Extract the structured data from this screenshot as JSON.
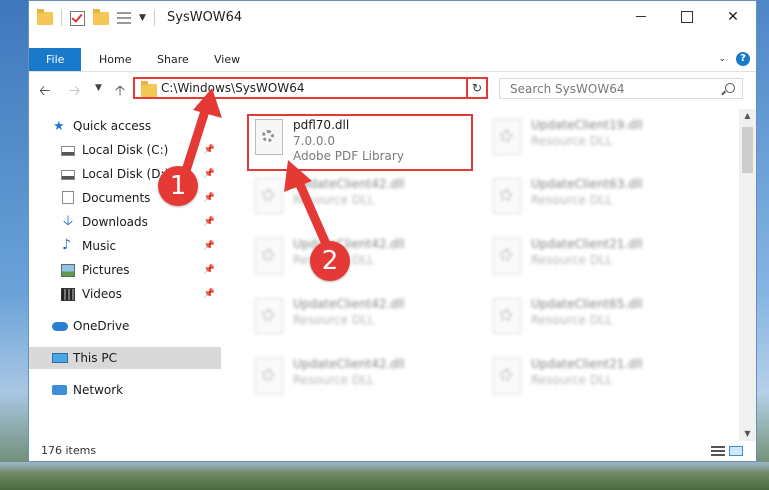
{
  "window": {
    "title": "SysWOW64"
  },
  "ribbon": {
    "tabs": [
      "File",
      "Home",
      "Share",
      "View"
    ]
  },
  "navbar": {
    "address": "C:\\Windows\\SysWOW64",
    "search_placeholder": "Search SysWOW64"
  },
  "sidebar": {
    "items": [
      {
        "label": "Quick access",
        "icon": "star-icon"
      },
      {
        "label": "Local Disk (C:)",
        "icon": "drive-icon"
      },
      {
        "label": "Local Disk (D:)",
        "icon": "drive-icon"
      },
      {
        "label": "Documents",
        "icon": "documents-icon"
      },
      {
        "label": "Downloads",
        "icon": "downloads-icon"
      },
      {
        "label": "Music",
        "icon": "music-icon"
      },
      {
        "label": "Pictures",
        "icon": "pictures-icon"
      },
      {
        "label": "Videos",
        "icon": "videos-icon"
      },
      {
        "label": "OneDrive",
        "icon": "cloud-icon"
      },
      {
        "label": "This PC",
        "icon": "computer-icon"
      },
      {
        "label": "Network",
        "icon": "network-icon"
      }
    ]
  },
  "files": [
    {
      "name": "pdfl70.dll",
      "version": "7.0.0.0",
      "description": "Adobe PDF Library"
    },
    {
      "name": "UpdateClient19.dll",
      "version": "",
      "description": "Resource DLL"
    },
    {
      "name": "UpdateClient42.dll",
      "version": "",
      "description": "Resource DLL"
    },
    {
      "name": "UpdateClient63.dll",
      "version": "",
      "description": "Resource DLL"
    },
    {
      "name": "UpdateClient42.dll",
      "version": "",
      "description": "Resource DLL"
    },
    {
      "name": "UpdateClient21.dll",
      "version": "",
      "description": "Resource DLL"
    },
    {
      "name": "UpdateClient42.dll",
      "version": "",
      "description": "Resource DLL"
    },
    {
      "name": "UpdateClient65.dll",
      "version": "",
      "description": "Resource DLL"
    },
    {
      "name": "UpdateClient42.dll",
      "version": "",
      "description": "Resource DLL"
    },
    {
      "name": "UpdateClient21.dll",
      "version": "",
      "description": "Resource DLL"
    }
  ],
  "status": {
    "item_count": "176 items"
  },
  "annotations": {
    "badge1": "1",
    "badge2": "2"
  },
  "colors": {
    "accent": "#1979ca",
    "highlight": "#e53935"
  }
}
